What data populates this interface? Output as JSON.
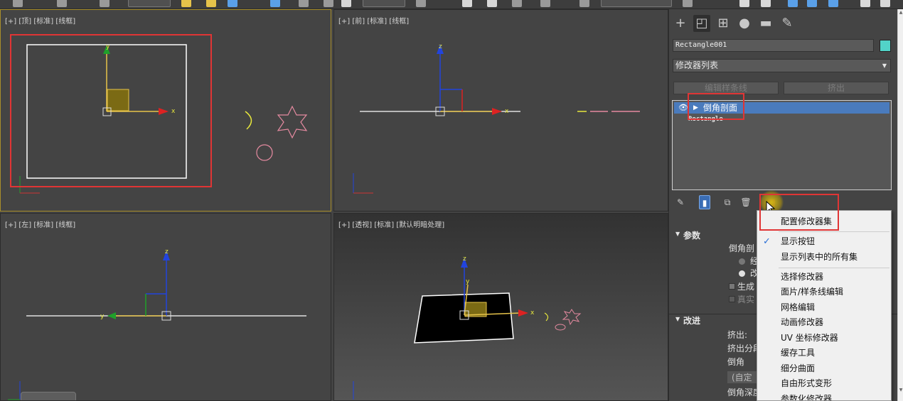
{
  "viewports": {
    "top": {
      "label": "[+] [顶] [标准] [线框]",
      "axis_y": "y",
      "axis_x": "x"
    },
    "front": {
      "label": "[+] [前] [标准] [线框]",
      "axis_z": "z",
      "axis_x": "x"
    },
    "left": {
      "label": "[+] [左] [标准] [线框]",
      "axis_z": "z",
      "axis_y": "y"
    },
    "perspective": {
      "label": "[+] [透视] [标准] [默认明暗处理]",
      "axis_z": "z",
      "axis_y": "y",
      "axis_x": "x"
    }
  },
  "command_panel": {
    "tabs": [
      "plus-icon",
      "modify-icon",
      "hierarchy-icon",
      "motion-icon",
      "display-icon",
      "utilities-icon"
    ],
    "object_name": "Rectangle001",
    "object_color": "#52d3c8",
    "modifier_list_label": "修改器列表",
    "buttons": {
      "edit_spline": "编辑样条线",
      "extrude": "挤出"
    },
    "stack": {
      "selected": "倒角剖面",
      "base": "Rectangle"
    },
    "rollouts": {
      "params": {
        "title": "参数",
        "group_label": "倒角剖",
        "radio1": "经",
        "radio2": "改",
        "check1": "生成",
        "check2": "真实"
      },
      "improve": {
        "title": "改进",
        "extrude": "挤出:",
        "extrude_seg": "挤出分段",
        "bevel": "倒角",
        "custom": "(自定",
        "bevel_depth": "倒角深度"
      }
    }
  },
  "context_menu": {
    "items": [
      {
        "label": "配置修改器集",
        "checked": false
      },
      {
        "label": "显示按钮",
        "checked": true
      },
      {
        "label": "显示列表中的所有集",
        "checked": false
      },
      {
        "label": "选择修改器",
        "checked": false
      },
      {
        "label": "面片/样条线编辑",
        "checked": false
      },
      {
        "label": "网格编辑",
        "checked": false
      },
      {
        "label": "动画修改器",
        "checked": false
      },
      {
        "label": "UV 坐标修改器",
        "checked": false
      },
      {
        "label": "缓存工具",
        "checked": false
      },
      {
        "label": "细分曲面",
        "checked": false
      },
      {
        "label": "自由形式变形",
        "checked": false
      },
      {
        "label": "参数化修改器",
        "checked": false
      }
    ],
    "check_glyph": "✓"
  },
  "colors": {
    "highlight_box": "#e03535",
    "active_viewport": "#a88e2a",
    "selection": "#4a7bbd"
  }
}
